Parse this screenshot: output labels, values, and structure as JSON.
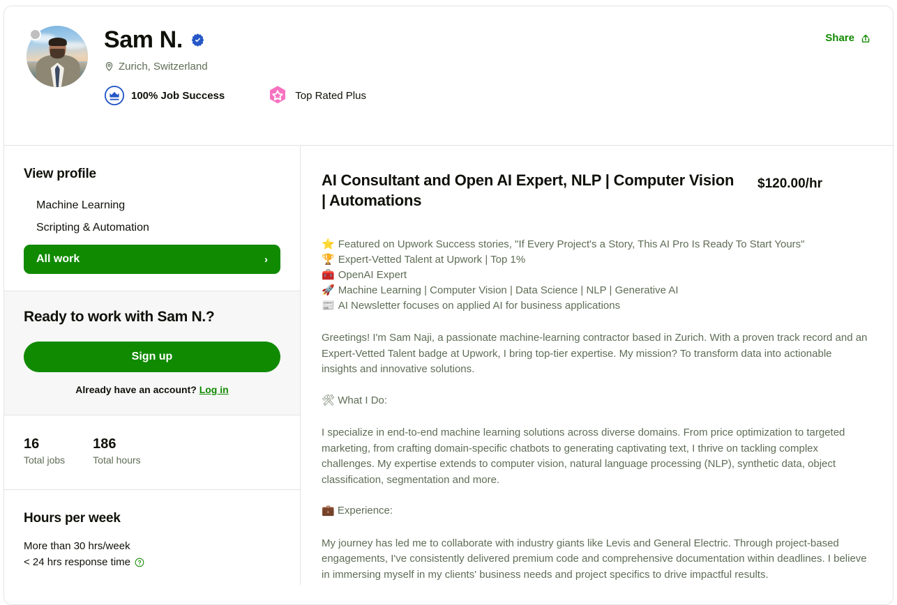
{
  "profile": {
    "name": "Sam N.",
    "verified_icon": "verified-badge-icon",
    "location": "Zurich, Switzerland",
    "location_icon": "location-pin-icon",
    "job_success": "100% Job Success",
    "job_success_icon": "job-success-crown-icon",
    "top_rated": "Top Rated Plus",
    "top_rated_icon": "top-rated-plus-hexagon-icon",
    "status_icon": "offline-status-dot",
    "avatar_icon": "profile-avatar"
  },
  "header": {
    "share_label": "Share",
    "share_icon": "share-upload-icon"
  },
  "sidebar": {
    "nav_title": "View profile",
    "nav_items": [
      {
        "label": "Machine Learning"
      },
      {
        "label": "Scripting & Automation"
      }
    ],
    "active_item": {
      "label": "All work",
      "chevron": "›"
    },
    "signup": {
      "title": "Ready to work with Sam N.?",
      "button": "Sign up",
      "account_prompt": "Already have an account?",
      "login_label": "Log in"
    },
    "stats": [
      {
        "value": "16",
        "label": "Total jobs"
      },
      {
        "value": "186",
        "label": "Total hours"
      }
    ],
    "hours": {
      "title": "Hours per week",
      "availability": "More than 30 hrs/week",
      "response_time": "< 24 hrs response time",
      "help_icon": "help-question-icon"
    }
  },
  "main": {
    "job_title": "AI Consultant and Open AI Expert, NLP | Computer Vision | Automations",
    "rate": "$120.00/hr",
    "highlights": [
      {
        "emoji": "⭐",
        "text": "Featured on Upwork Success stories, \"If Every Project's a Story, This AI Pro Is Ready To Start Yours\""
      },
      {
        "emoji": "🏆",
        "text": "Expert-Vetted Talent at Upwork | Top 1%"
      },
      {
        "emoji": "🧰",
        "text": "OpenAI Expert"
      },
      {
        "emoji": "🚀",
        "text": "Machine Learning | Computer Vision | Data Science | NLP | Generative AI"
      },
      {
        "emoji": "📰",
        "text": "AI Newsletter focuses on applied AI for business applications"
      }
    ],
    "paragraph_1": "Greetings! I'm Sam Naji, a passionate machine-learning contractor based in Zurich. With a proven track record and an Expert-Vetted Talent badge at Upwork, I bring top-tier expertise. My mission? To transform data into actionable insights and innovative solutions.",
    "heading_what_i_do": "🛠 What I Do:",
    "paragraph_2": "I specialize in end-to-end machine learning solutions across diverse domains. From price optimization to targeted marketing, from crafting domain-specific chatbots to generating captivating text, I thrive on tackling complex challenges. My expertise extends to computer vision, natural language processing (NLP), synthetic data, object classification, segmentation and more.",
    "heading_experience": "💼 Experience:",
    "paragraph_3": "My journey has led me to collaborate with industry giants like Levis and General Electric. Through project-based engagements, I've consistently delivered premium code and comprehensive documentation within deadlines. I believe in immersing myself in my clients' business needs and project specifics to drive impactful results."
  },
  "colors": {
    "brand_green": "#108a00",
    "verified_blue": "#2557c7",
    "top_rated_pink": "#f772c0",
    "text_dark": "#0f1109",
    "text_muted": "#5e6d55"
  }
}
